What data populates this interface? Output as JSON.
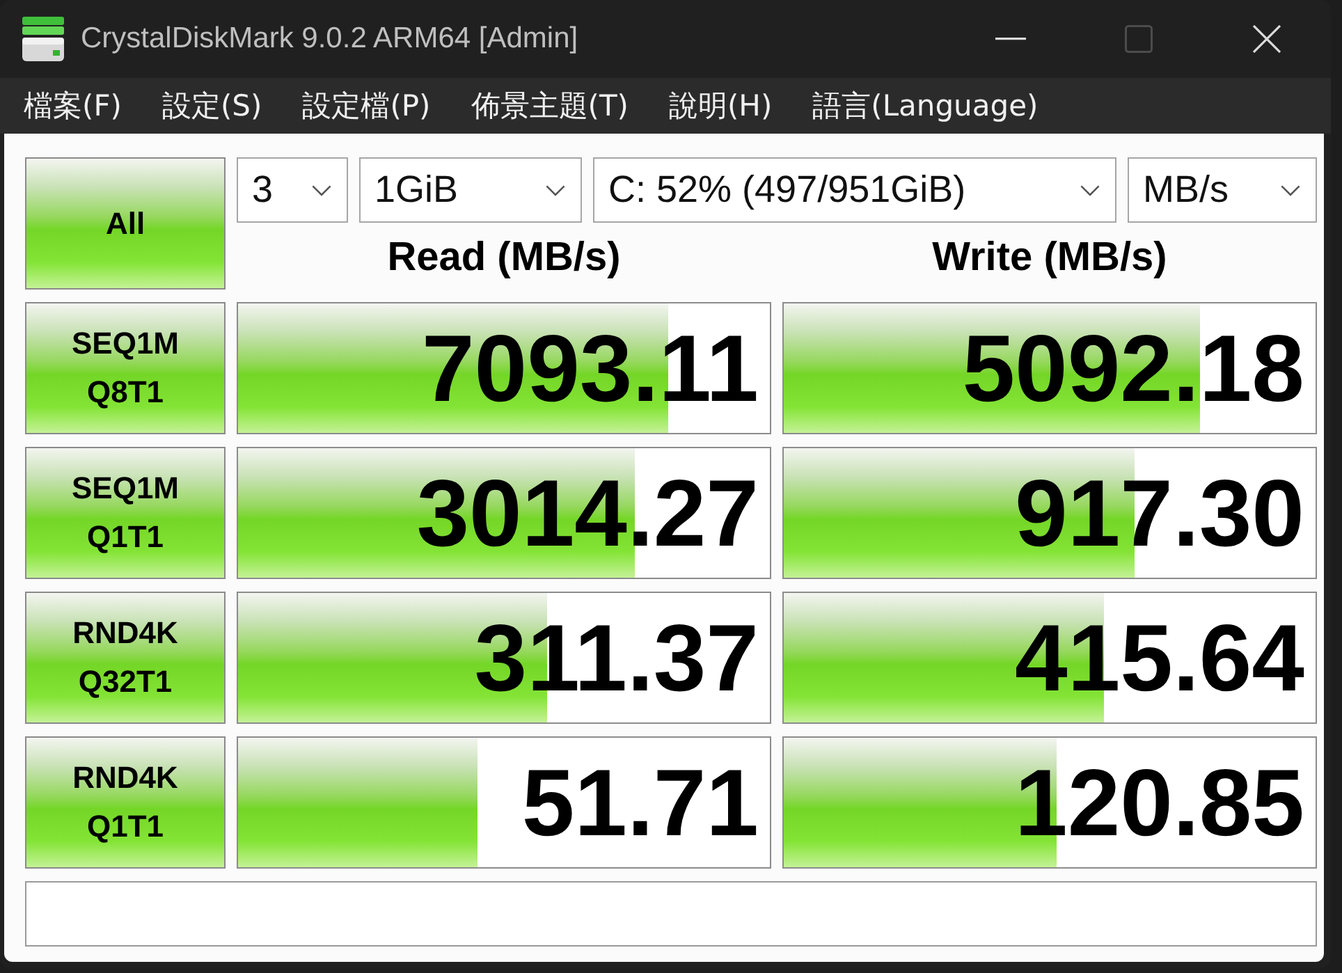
{
  "window": {
    "title": "CrystalDiskMark 9.0.2 ARM64 [Admin]",
    "controls": [
      {
        "kind": "minimize",
        "disabled": false
      },
      {
        "kind": "maximize",
        "disabled": true
      },
      {
        "kind": "close",
        "disabled": false
      }
    ]
  },
  "menu": [
    "檔案(F)",
    "設定(S)",
    "設定檔(P)",
    "佈景主題(T)",
    "說明(H)",
    "語言(Language)"
  ],
  "all_button": "All",
  "dropdowns": [
    {
      "value": "3"
    },
    {
      "value": "1GiB"
    },
    {
      "value": "C: 52% (497/951GiB)"
    },
    {
      "value": "MB/s"
    }
  ],
  "columns": [
    "Read (MB/s)",
    "Write (MB/s)"
  ],
  "tests": [
    {
      "name": "SEQ1M",
      "params": "Q8T1",
      "read": {
        "value": "7093.11",
        "level": 0.81
      },
      "write": {
        "value": "5092.18",
        "level": 0.783
      }
    },
    {
      "name": "SEQ1M",
      "params": "Q1T1",
      "read": {
        "value": "3014.27",
        "level": 0.746
      },
      "write": {
        "value": "917.30",
        "level": 0.66
      }
    },
    {
      "name": "RND4K",
      "params": "Q32T1",
      "read": {
        "value": "311.37",
        "level": 0.58
      },
      "write": {
        "value": "415.64",
        "level": 0.602
      }
    },
    {
      "name": "RND4K",
      "params": "Q1T1",
      "read": {
        "value": "51.71",
        "level": 0.45
      },
      "write": {
        "value": "120.85",
        "level": 0.513
      }
    }
  ]
}
